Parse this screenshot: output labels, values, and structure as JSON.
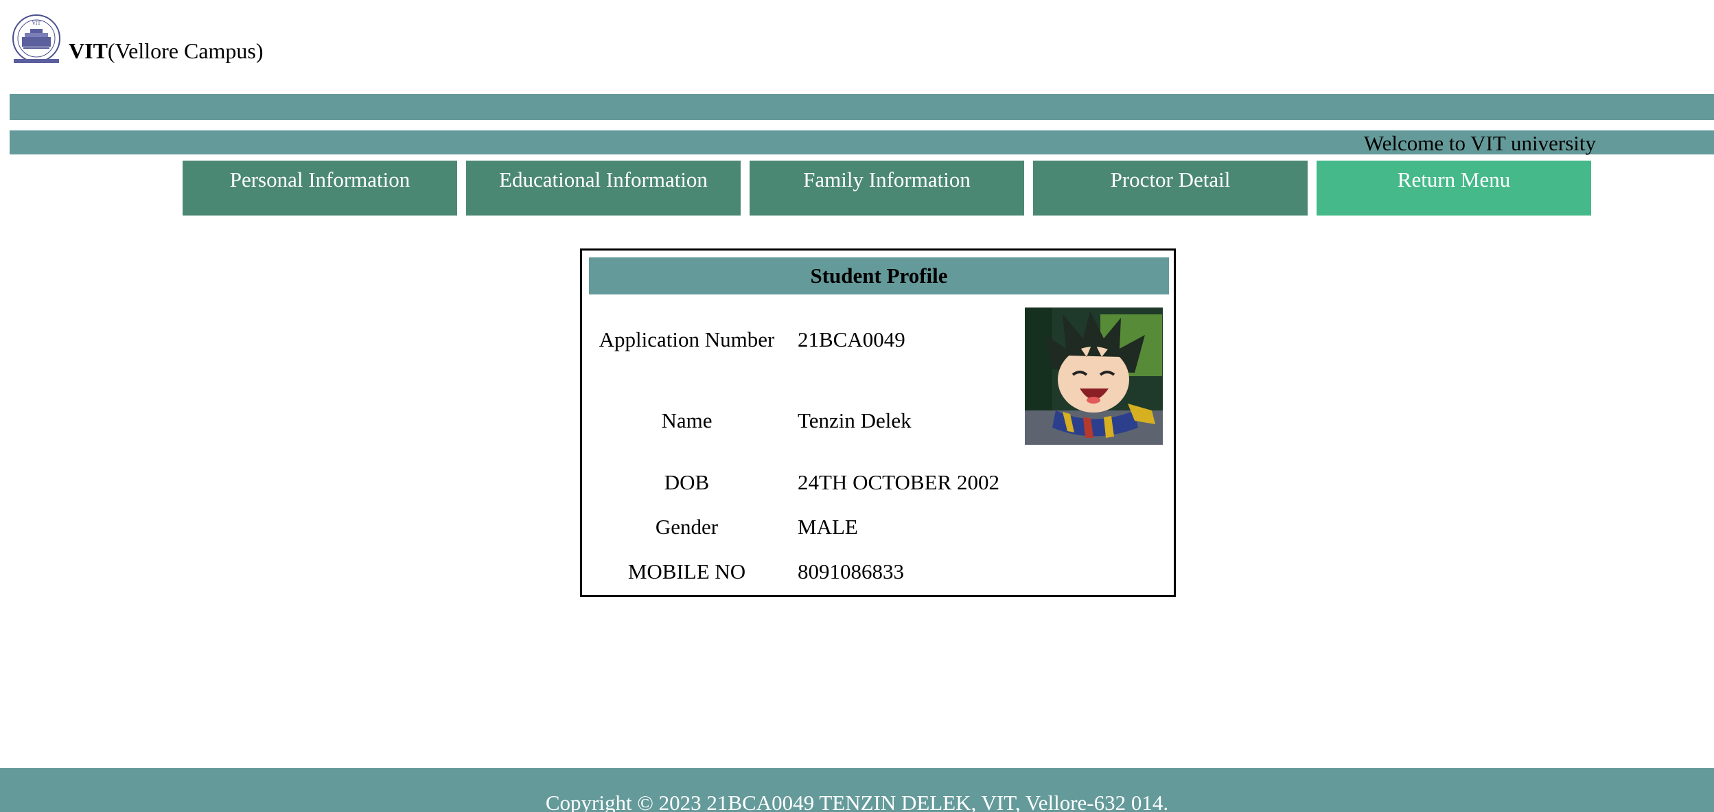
{
  "header": {
    "brand_bold": "VIT",
    "brand_rest": "(Vellore Campus)",
    "logo_icon": "vit-seal-logo"
  },
  "banner": {
    "welcome": "Welcome to VIT university"
  },
  "nav": [
    {
      "label": "Personal Information"
    },
    {
      "label": "Educational Information"
    },
    {
      "label": "Family Information"
    },
    {
      "label": "Proctor Detail"
    },
    {
      "label": "Return Menu"
    }
  ],
  "profile": {
    "title": "Student Profile",
    "rows": [
      {
        "label": "Application Number",
        "value": "21BCA0049"
      },
      {
        "label": "Name",
        "value": "Tenzin Delek"
      },
      {
        "label": "DOB",
        "value": "24TH OCTOBER 2002"
      },
      {
        "label": "Gender",
        "value": "MALE"
      },
      {
        "label": "MOBILE NO",
        "value": "8091086833"
      }
    ],
    "photo_icon": "student-photo"
  },
  "footer": {
    "text": "Copyright © 2023 21BCA0049 TENZIN DELEK, VIT, Vellore-632 014."
  },
  "colors": {
    "bar": "#659a9a",
    "nav_button": "#4b8873",
    "nav_button_active": "#45b98a"
  }
}
